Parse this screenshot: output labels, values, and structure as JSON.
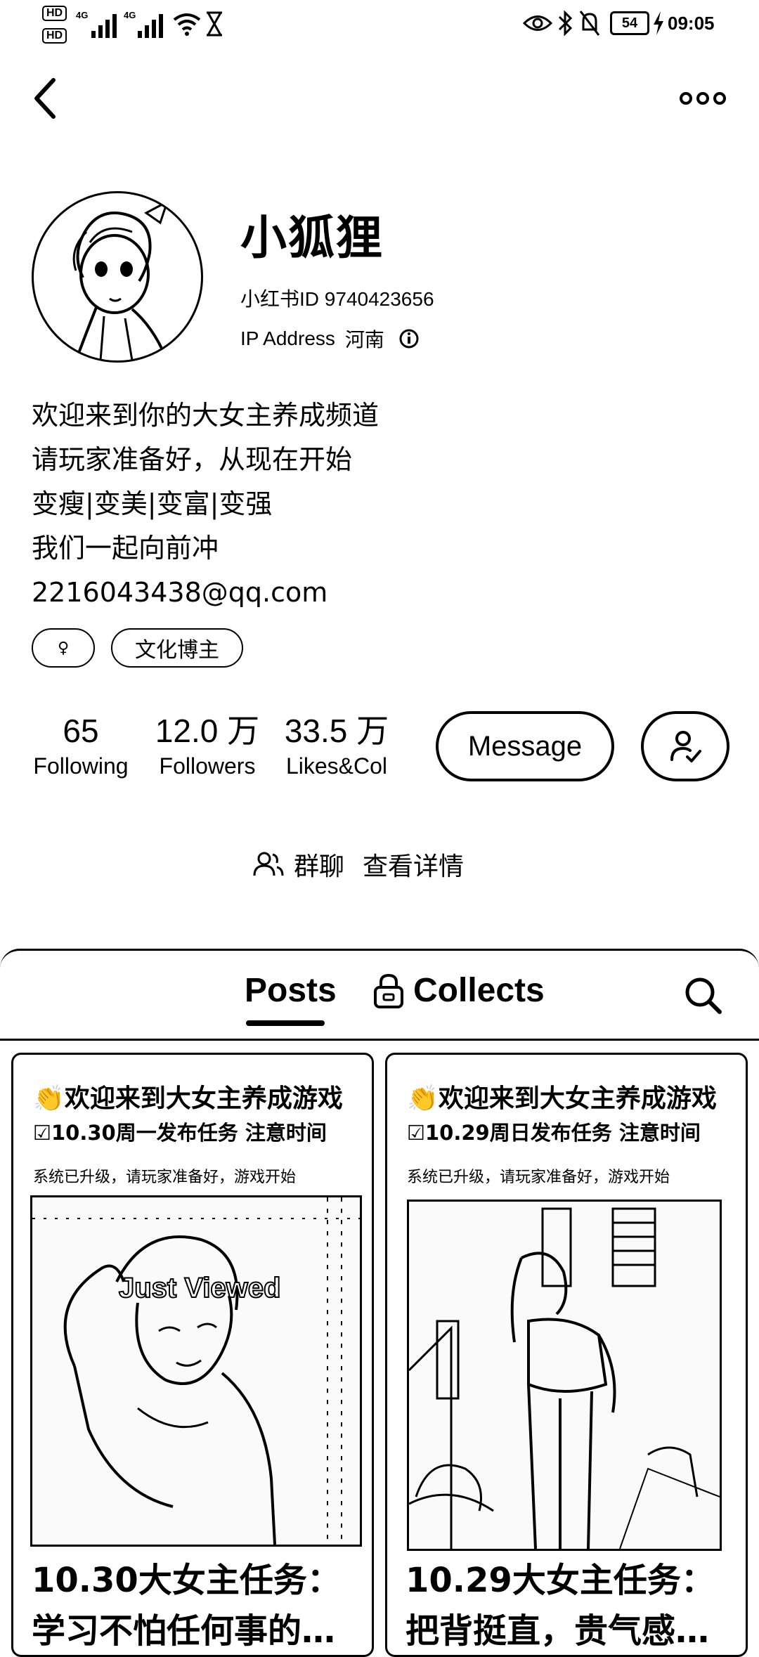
{
  "status_bar": {
    "hd1": "HD",
    "hd2": "HD",
    "net1": "4G",
    "net2": "4G",
    "battery": "54",
    "time": "09:05"
  },
  "nav": {
    "back_icon": "chevron-left-icon",
    "more_icon": "more-dots-icon"
  },
  "profile": {
    "name": "小狐狸",
    "id_label": "小红书ID",
    "id_value": "9740423656",
    "ip_label": "IP Address",
    "ip_value": "河南",
    "bio": [
      "欢迎来到你的大女主养成频道",
      "请玩家准备好，从现在开始",
      "变瘦|变美|变富|变强",
      "我们一起向前冲",
      "2216043438@qq.com"
    ],
    "tags": [
      "♀",
      "文化博主"
    ]
  },
  "stats": [
    {
      "value": "65",
      "label": "Following"
    },
    {
      "value": "12.0 万",
      "label": "Followers"
    },
    {
      "value": "33.5 万",
      "label": "Likes&Col"
    }
  ],
  "actions": {
    "message_label": "Message"
  },
  "group": {
    "label": "群聊",
    "link": "查看详情"
  },
  "tabs": {
    "posts": "Posts",
    "collects": "Collects"
  },
  "posts": [
    {
      "line1": "👏欢迎来到大女主养成游戏",
      "line2": "☑10.30周一发布任务 注意时间",
      "line3": "系统已升级，请玩家准备好，游戏开始",
      "overlay": "Just Viewed",
      "caption": "10.30大女主任务：学习不怕任何事的…"
    },
    {
      "line1": "👏欢迎来到大女主养成游戏",
      "line2": "☑10.29周日发布任务 注意时间",
      "line3": "系统已升级，请玩家准备好，游戏开始",
      "caption": "10.29大女主任务：把背挺直，贵气感…"
    }
  ],
  "colors": {
    "ink": "#000000",
    "background": "#ffffff"
  }
}
